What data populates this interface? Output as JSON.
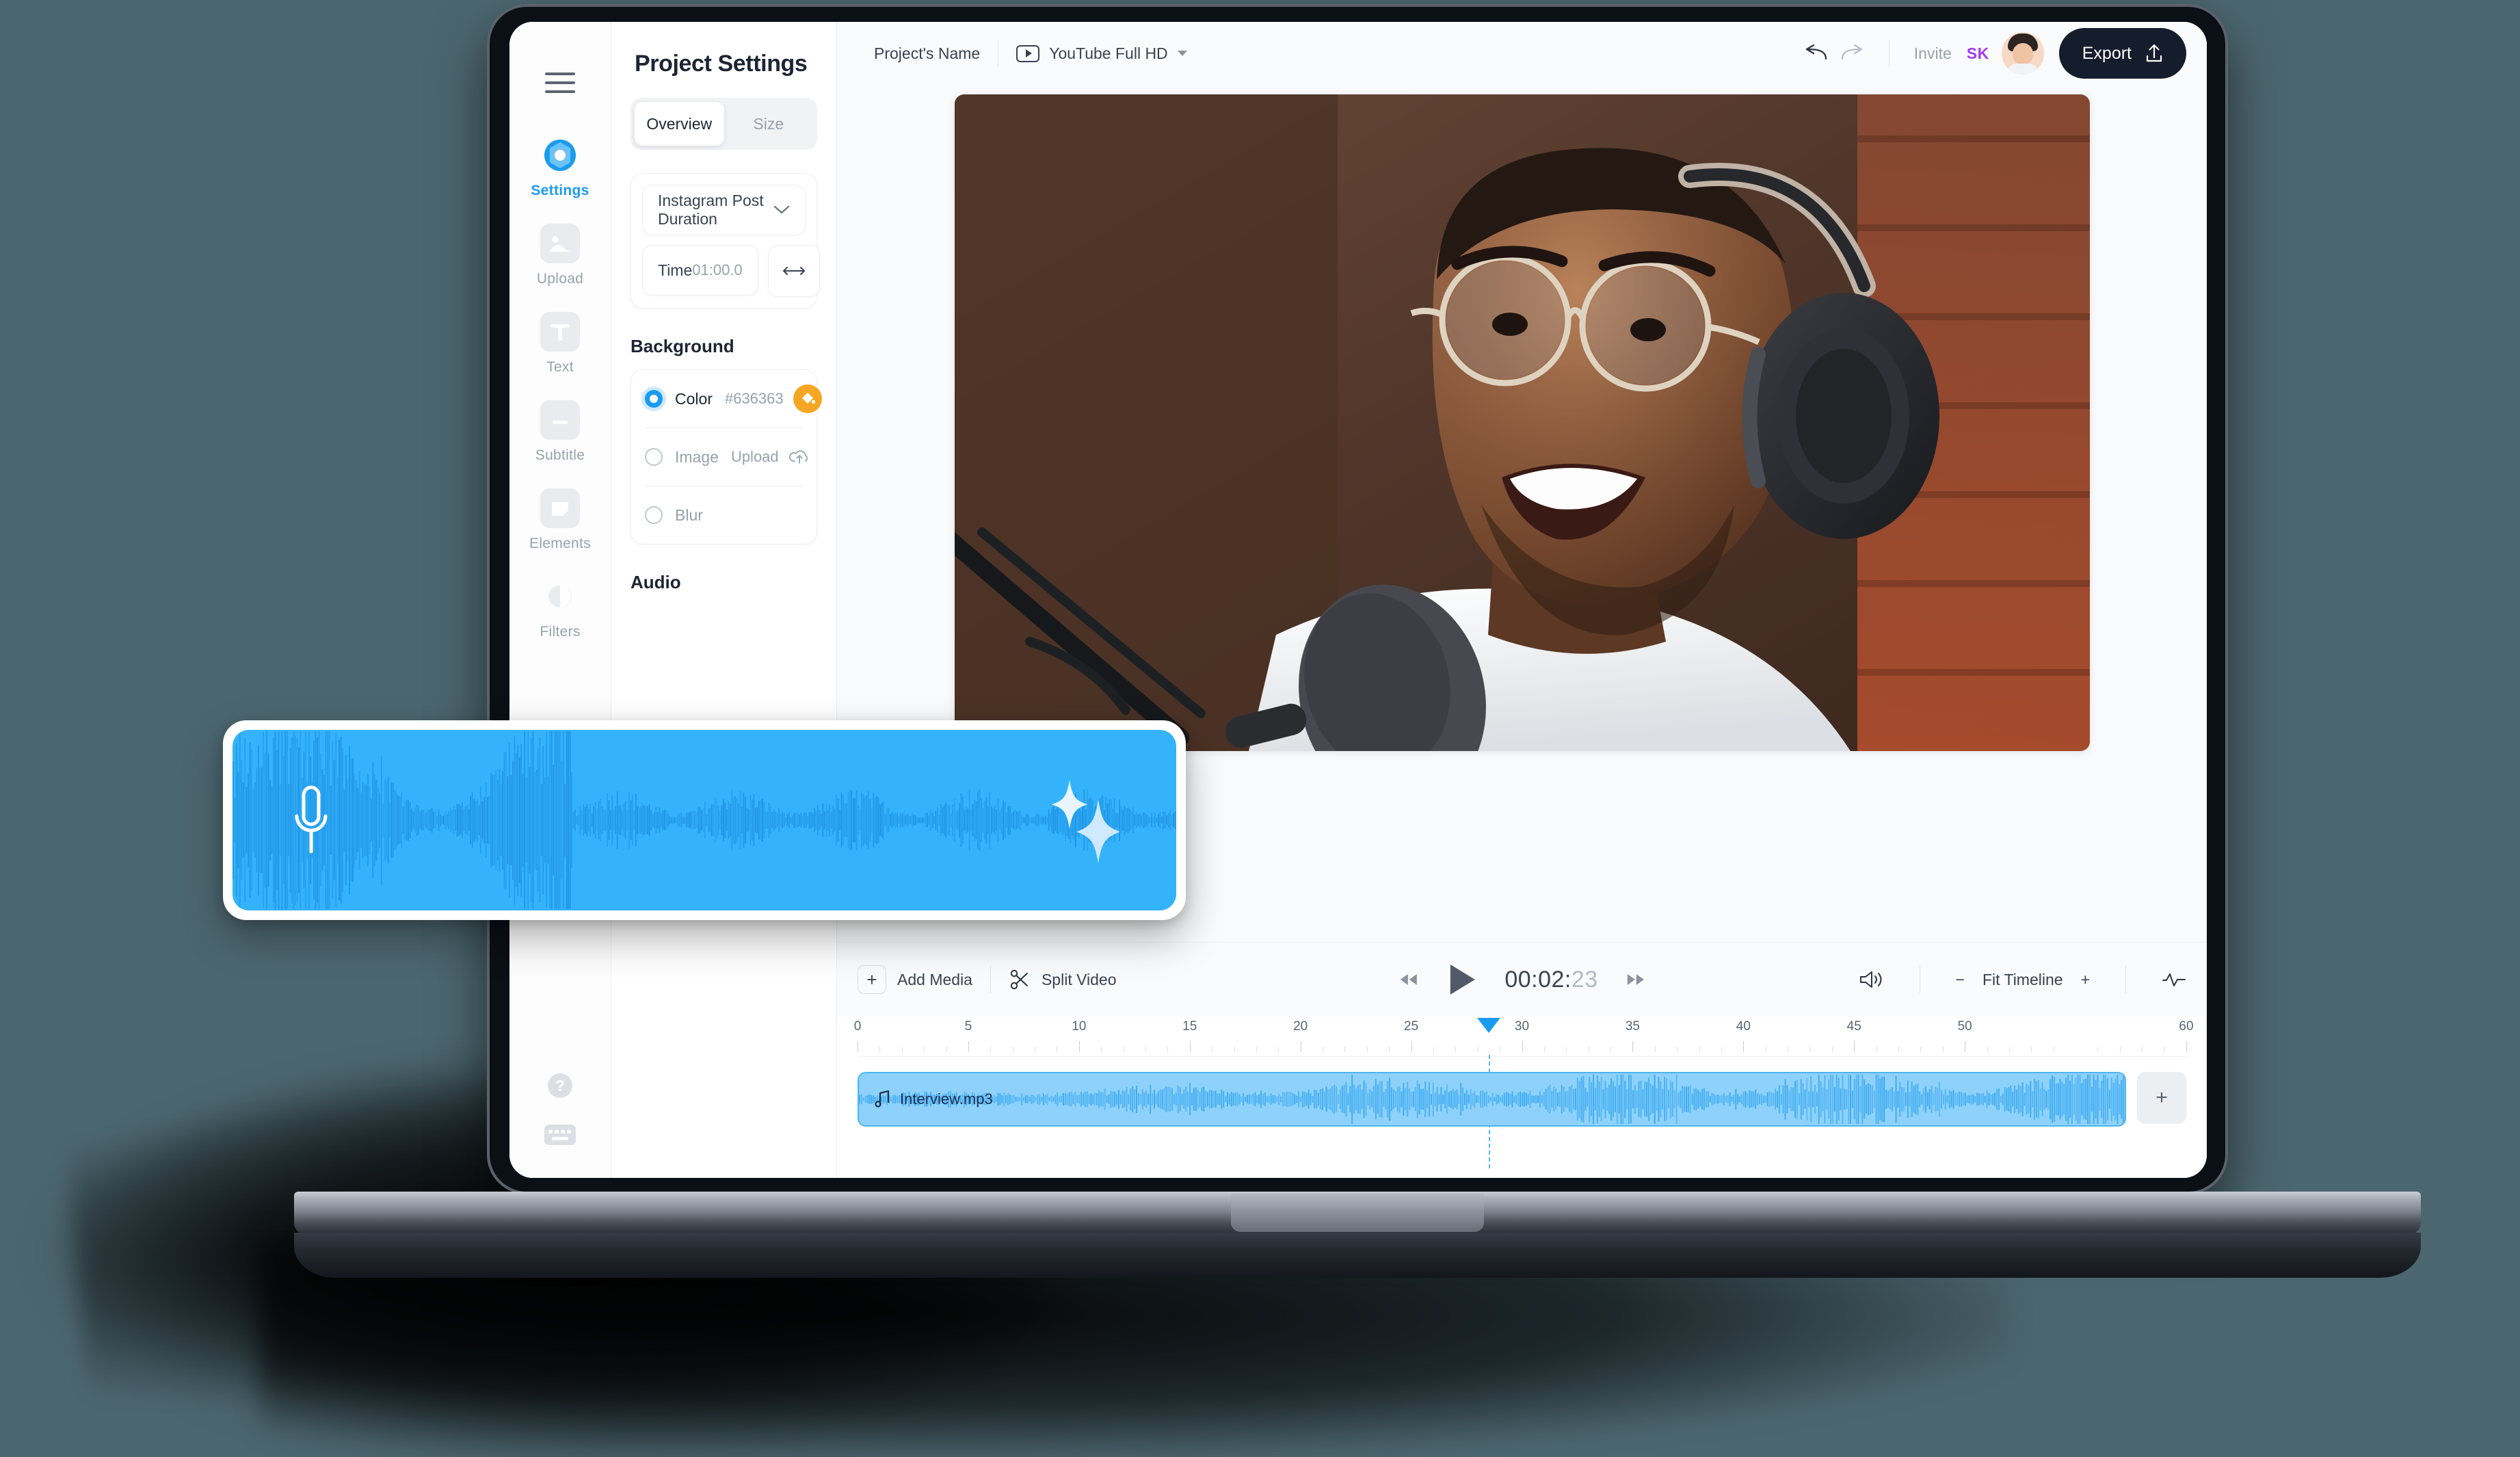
{
  "background_color": "#4c666f",
  "accent": "#1a9bf0",
  "rail": {
    "menu_icon": "hamburger-icon",
    "items": [
      {
        "label": "Settings",
        "icon": "settings-gear-icon",
        "active": true
      },
      {
        "label": "Upload",
        "icon": "image-upload-icon",
        "active": false
      },
      {
        "label": "Text",
        "icon": "text-T-icon",
        "active": false
      },
      {
        "label": "Subtitle",
        "icon": "subtitle-icon",
        "active": false
      },
      {
        "label": "Elements",
        "icon": "elements-shape-icon",
        "active": false
      },
      {
        "label": "Filters",
        "icon": "filters-contrast-icon",
        "active": false
      }
    ],
    "bottom": [
      {
        "icon": "help-question-icon"
      },
      {
        "icon": "keyboard-shortcuts-icon"
      }
    ]
  },
  "panel": {
    "title": "Project Settings",
    "tabs": [
      {
        "label": "Overview",
        "active": true
      },
      {
        "label": "Size",
        "active": false
      }
    ],
    "duration_preset": "Instagram Post Duration",
    "time_label": "Time",
    "time_value": "01:00.0",
    "swap_icon": "left-right-arrow-icon",
    "background_section": "Background",
    "background_options": [
      {
        "label": "Color",
        "selected": true,
        "value": "#636363",
        "action_icon": "paint-bucket-icon"
      },
      {
        "label": "Image",
        "selected": false,
        "value": "Upload",
        "action_icon": "cloud-upload-icon"
      },
      {
        "label": "Blur",
        "selected": false,
        "value": "",
        "action_icon": ""
      }
    ],
    "audio_section": "Audio"
  },
  "topbar": {
    "project_name": "Project's Name",
    "ratio_label": "YouTube Full HD",
    "ratio_icon": "youtube-play-icon",
    "undo_icon": "undo-arrow-icon",
    "redo_icon": "redo-arrow-icon",
    "invite_label": "Invite",
    "collaborator_initials": "SK",
    "avatar_icon": "user-avatar",
    "export_label": "Export",
    "export_icon": "share-upload-icon"
  },
  "preview": {
    "description": "Smiling man wearing glasses and over-ear headphones speaking into a studio microphone"
  },
  "controls": {
    "add_media_label": "Add Media",
    "add_media_icon": "plus-icon",
    "split_video_label": "Split Video",
    "split_video_icon": "scissors-icon",
    "rewind_icon": "rewind-icon",
    "play_icon": "play-icon",
    "forward_icon": "fast-forward-icon",
    "current_time": "00:02:",
    "current_time_frames": "23",
    "volume_icon": "speaker-volume-icon",
    "zoom_out_label": "−",
    "fit_label": "Fit Timeline",
    "zoom_in_label": "+",
    "waveform_icon": "audio-waveform-icon"
  },
  "timeline": {
    "ruler_labels": [
      "0",
      "5",
      "10",
      "15",
      "20",
      "25",
      "30",
      "35",
      "40",
      "45",
      "50",
      "60"
    ],
    "ruler_max": 60,
    "playhead_seconds": 28.5,
    "clip": {
      "name": "Interview.mp3",
      "icon": "music-note-icon"
    },
    "add_track_label": "+"
  },
  "floating_audio_card": {
    "mic_icon": "microphone-icon",
    "sparkle_icon": "sparkles-icon",
    "card_color": "#34b3fb"
  }
}
